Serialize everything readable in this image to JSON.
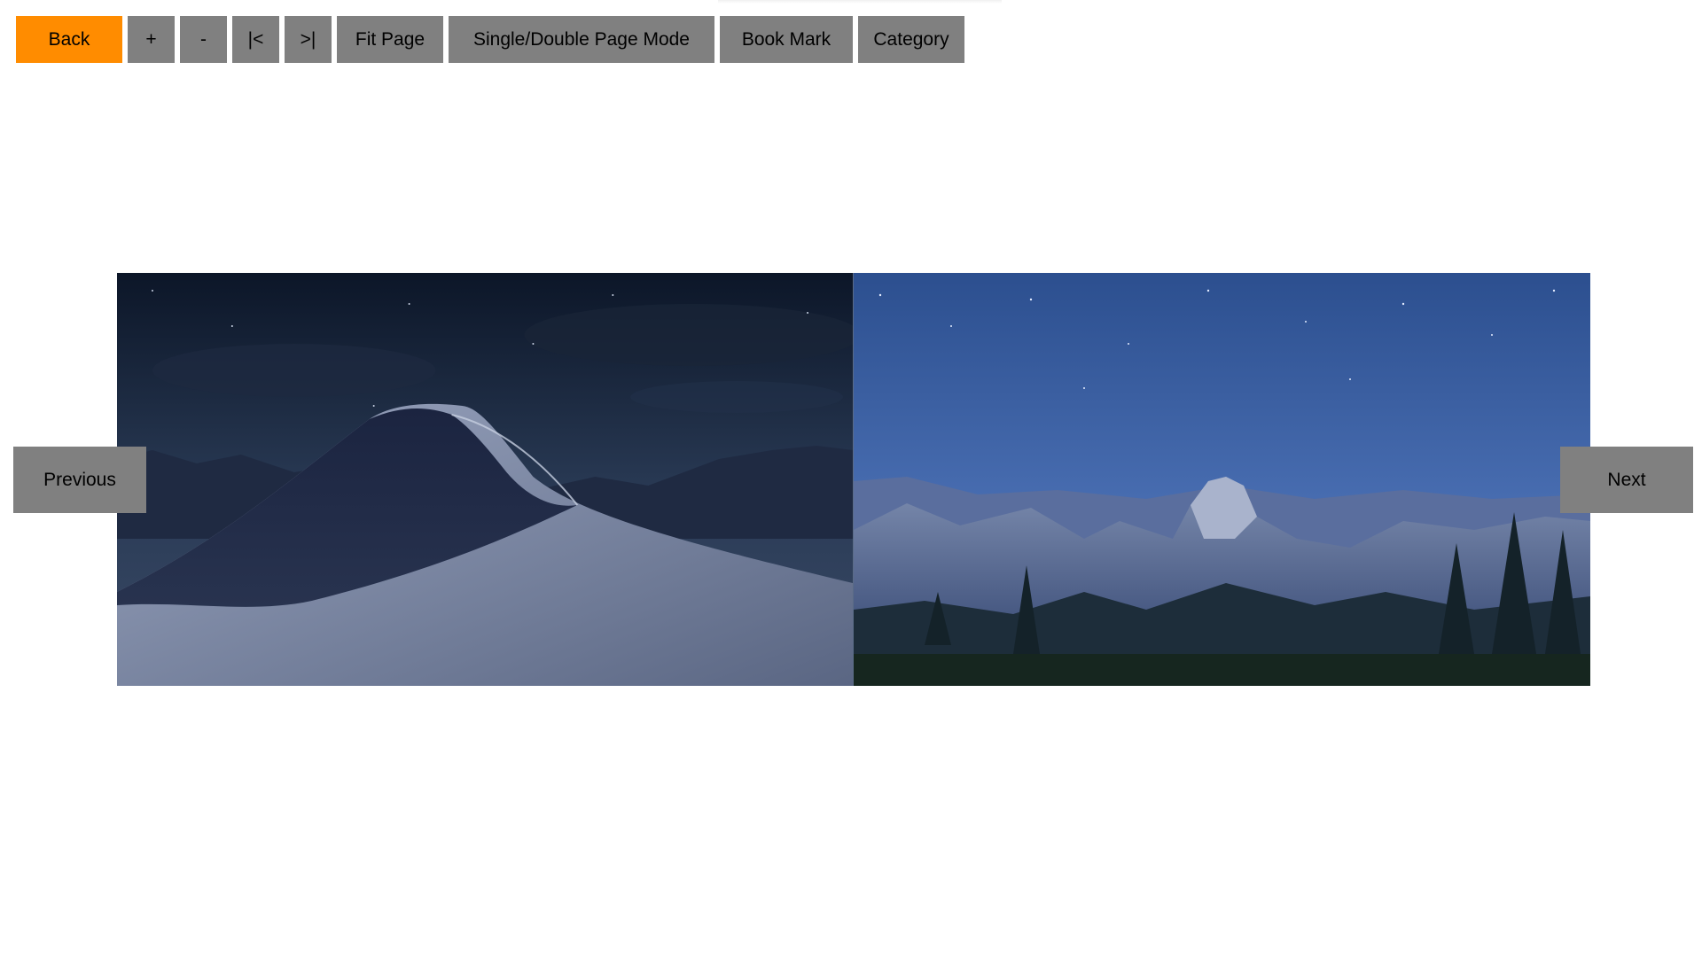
{
  "toolbar": {
    "back_label": "Back",
    "zoom_in_label": "+",
    "zoom_out_label": "-",
    "first_page_label": "|<",
    "last_page_label": ">|",
    "fit_page_label": "Fit Page",
    "page_mode_label": "Single/Double Page Mode",
    "bookmark_label": "Book Mark",
    "category_label": "Category"
  },
  "navigation": {
    "previous_label": "Previous",
    "next_label": "Next"
  },
  "colors": {
    "accent": "#ff8c00",
    "button_gray": "#808080",
    "background": "#ffffff"
  },
  "pages": [
    {
      "content": "desert sand dune under night sky"
    },
    {
      "content": "mountain valley under starry blue sky"
    }
  ]
}
